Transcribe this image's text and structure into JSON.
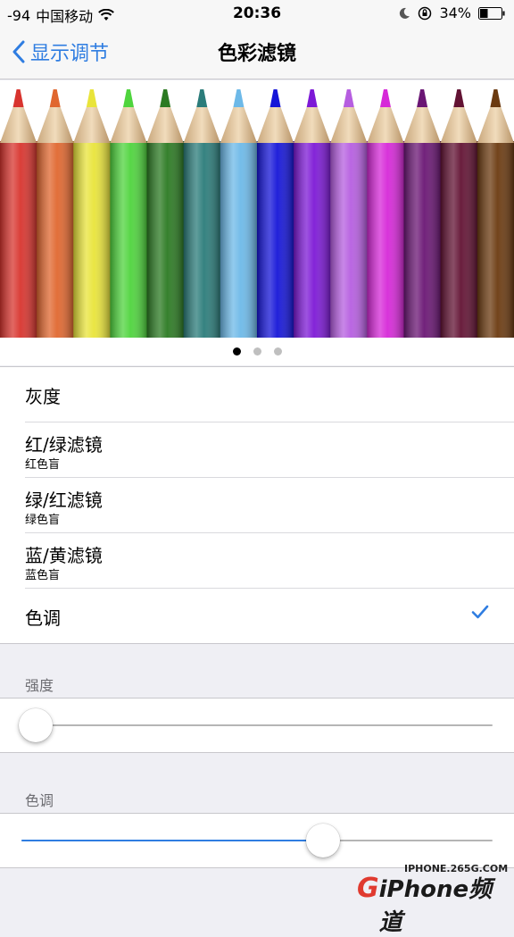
{
  "status_bar": {
    "signal": "-94",
    "carrier": "中国移动",
    "time": "20:36",
    "battery": "34%",
    "icons": [
      "wifi-icon",
      "moon-icon",
      "orientation-lock-icon",
      "battery-icon"
    ]
  },
  "nav": {
    "back_label": "显示调节",
    "title": "色彩滤镜"
  },
  "banner": {
    "pencil_colors": [
      "#d8342e",
      "#e0672f",
      "#e9e43a",
      "#4fd43d",
      "#2b7a22",
      "#2b7c7a",
      "#6db9e8",
      "#1515d8",
      "#7d19d6",
      "#b65ee0",
      "#d628d8",
      "#6a1674",
      "#621233",
      "#6b3a10"
    ]
  },
  "pager": {
    "count": 3,
    "active": 0
  },
  "filters": [
    {
      "title": "灰度"
    },
    {
      "title": "红/绿滤镜",
      "subtitle": "红色盲"
    },
    {
      "title": "绿/红滤镜",
      "subtitle": "绿色盲"
    },
    {
      "title": "蓝/黄滤镜",
      "subtitle": "蓝色盲"
    },
    {
      "title": "色调",
      "selected": true
    }
  ],
  "intensity": {
    "label": "强度",
    "value": 0.03
  },
  "hue": {
    "label": "色调",
    "value": 0.64
  },
  "watermark": {
    "url": "IPHONE.265G.COM",
    "logo_g": "G",
    "logo_text": "iPhone频道"
  },
  "colors": {
    "accent": "#2f7de1",
    "background": "#efeff4"
  }
}
